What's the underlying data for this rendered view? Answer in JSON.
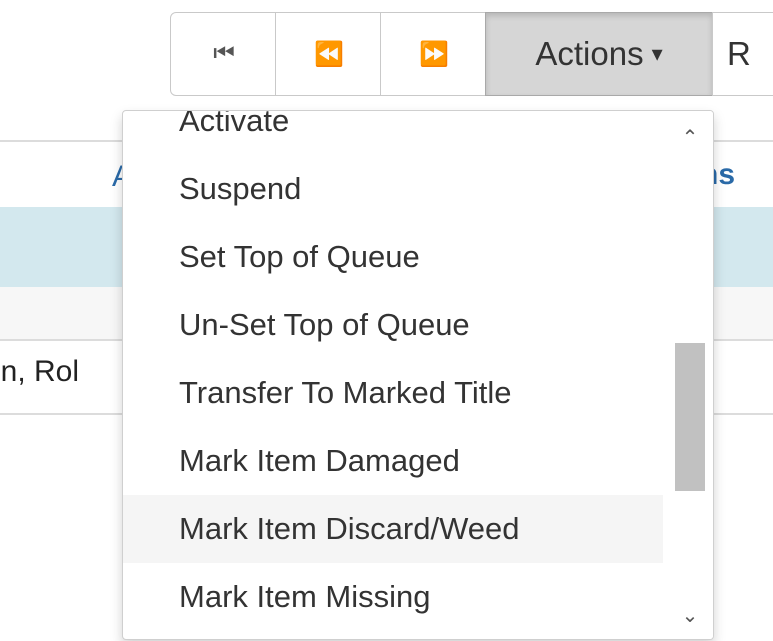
{
  "toolbar": {
    "first_icon": "first-page-icon",
    "prev_icon": "previous-page-icon",
    "next_icon": "next-page-icon",
    "first_glyph": "⏮",
    "prev_glyph": "⏪",
    "next_glyph": "⏩",
    "actions_label": "Actions",
    "actions_caret": "▾",
    "next_button_partial": "R"
  },
  "background": {
    "column_link_partial": "ns",
    "column_link2_partial": "A",
    "name_partial": "in, Rol"
  },
  "menu": {
    "items": [
      "Activate",
      "Suspend",
      "Set Top of Queue",
      "Un-Set Top of Queue",
      "Transfer To Marked Title",
      "Mark Item Damaged",
      "Mark Item Discard/Weed",
      "Mark Item Missing"
    ],
    "hovered_index": 6
  },
  "scrollbar": {
    "up_glyph": "⌃",
    "down_glyph": "⌄"
  }
}
